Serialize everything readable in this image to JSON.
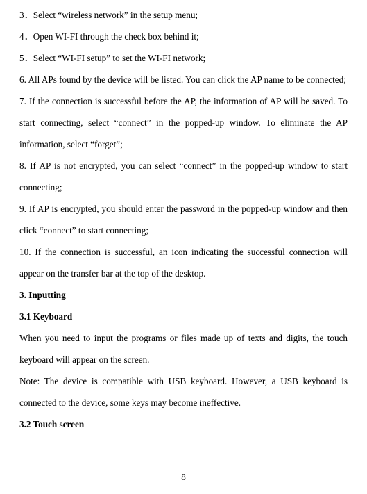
{
  "steps": {
    "s3": "3．Select “wireless network” in the setup menu;",
    "s4": "4．Open WI-FI through the check box behind it;",
    "s5": "5．Select “WI-FI setup” to set the WI-FI network;",
    "s6": "6. All APs found by the device will be listed. You can click the AP name to be connected;",
    "s7": "7. If the connection is successful before the AP, the information of AP will be saved. To start connecting, select “connect” in the popped-up window. To eliminate the AP information, select “forget”;",
    "s8": "8. If AP is not encrypted, you can select “connect” in the popped-up window to start connecting;",
    "s9": "9. If AP is encrypted, you should enter the password in the popped-up window and then click “connect” to start connecting;",
    "s10": "10. If the connection is successful, an icon indicating the successful connection will appear on the transfer bar at the top of the desktop."
  },
  "headings": {
    "h3": "3. Inputting",
    "h31": "3.1 Keyboard",
    "h32": "3.2 Touch screen"
  },
  "paragraphs": {
    "keyboard_intro": "When you need to input the programs or files made up of texts and digits, the touch keyboard will appear on the screen.",
    "keyboard_note": "Note: The device is compatible with USB keyboard. However, a USB keyboard is connected to the device, some keys may become ineffective."
  },
  "page_number": "8"
}
